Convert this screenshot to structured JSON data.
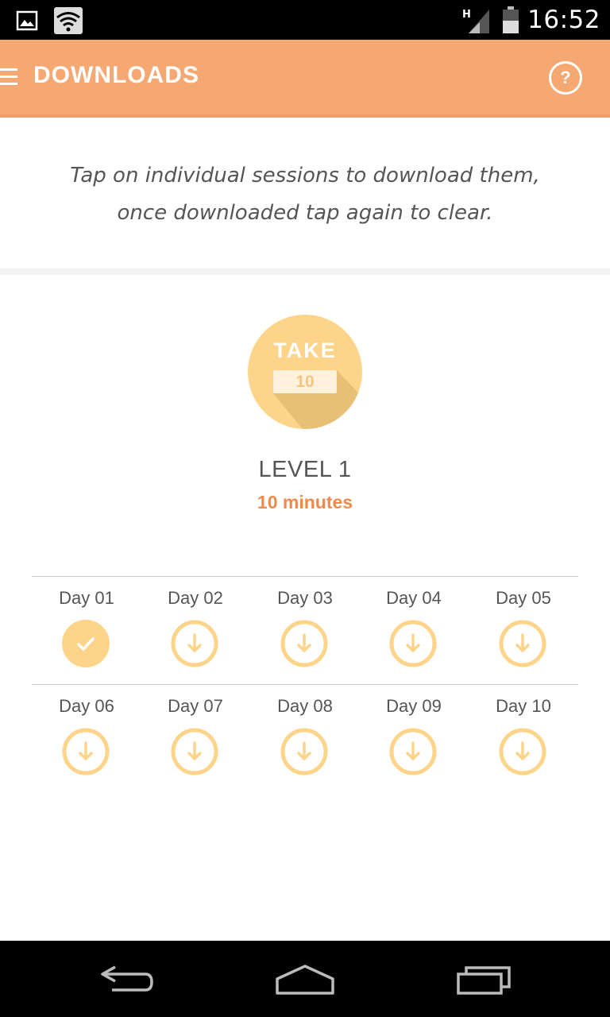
{
  "status_bar": {
    "time": "16:52",
    "network_type": "H",
    "icons": [
      "image-notification-icon",
      "wifi-notification-icon",
      "signal-icon",
      "battery-icon"
    ]
  },
  "app_bar": {
    "title": "DOWNLOADS",
    "menu_icon": "menu-icon",
    "help_icon": "help-icon",
    "help_glyph": "?",
    "background_color": "#f6a872"
  },
  "intro": {
    "text": "Tap on individual sessions to download them, once downloaded tap again to clear."
  },
  "level": {
    "badge_top_text": "TAKE",
    "badge_bottom_text": "10",
    "title": "LEVEL 1",
    "duration": "10 minutes",
    "accent_color": "#f08a4b",
    "badge_color": "#fdd48a"
  },
  "sessions": [
    {
      "label": "Day 01",
      "state": "downloaded",
      "icon": "check-icon"
    },
    {
      "label": "Day 02",
      "state": "not-downloaded",
      "icon": "download-icon"
    },
    {
      "label": "Day 03",
      "state": "not-downloaded",
      "icon": "download-icon"
    },
    {
      "label": "Day 04",
      "state": "not-downloaded",
      "icon": "download-icon"
    },
    {
      "label": "Day 05",
      "state": "not-downloaded",
      "icon": "download-icon"
    },
    {
      "label": "Day 06",
      "state": "not-downloaded",
      "icon": "download-icon"
    },
    {
      "label": "Day 07",
      "state": "not-downloaded",
      "icon": "download-icon"
    },
    {
      "label": "Day 08",
      "state": "not-downloaded",
      "icon": "download-icon"
    },
    {
      "label": "Day 09",
      "state": "not-downloaded",
      "icon": "download-icon"
    },
    {
      "label": "Day 10",
      "state": "not-downloaded",
      "icon": "download-icon"
    }
  ],
  "nav_bar": {
    "buttons": [
      "back-icon",
      "home-icon",
      "recent-apps-icon"
    ]
  }
}
